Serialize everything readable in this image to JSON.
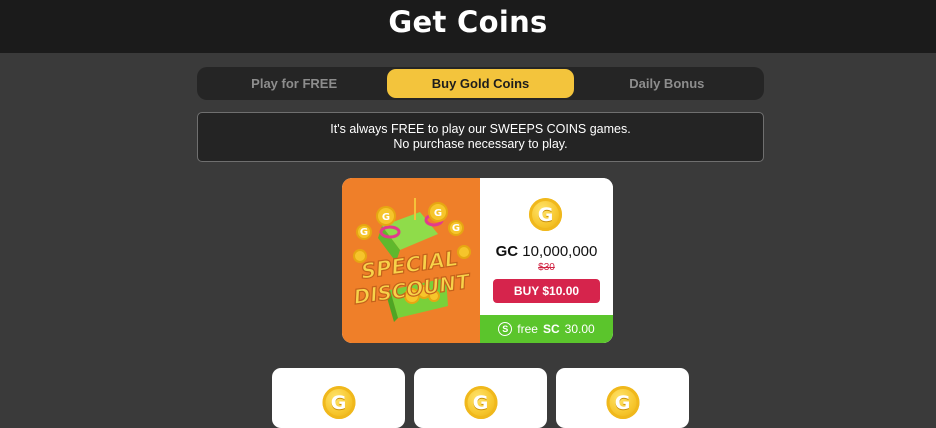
{
  "header": {
    "title": "Get Coins"
  },
  "tabs": [
    {
      "label": "Play for FREE",
      "active": false
    },
    {
      "label": "Buy Gold Coins",
      "active": true
    },
    {
      "label": "Daily Bonus",
      "active": false
    }
  ],
  "notice": {
    "line1": "It's always FREE to play our SWEEPS COINS games.",
    "line2": "No purchase necessary to play."
  },
  "promo": {
    "banner_line1": "SPECIAL",
    "banner_line2": "DISCOUNT",
    "coin_letter": "G",
    "gc_prefix": "GC",
    "gc_amount": "10,000,000",
    "old_price": "$30",
    "buy_label": "BUY $10.00",
    "free_prefix": "free",
    "sc_icon_letter": "S",
    "sc_label": "SC",
    "sc_amount": "30.00"
  },
  "cards": [
    {
      "coin_letter": "G"
    },
    {
      "coin_letter": "G"
    },
    {
      "coin_letter": "G"
    }
  ],
  "colors": {
    "accent": "#f3c43c",
    "buy": "#d6244c",
    "free_bar": "#5bc52c",
    "promo_bg": "#ef7f29"
  },
  "icons": [
    "gold-coin-icon",
    "sweeps-coin-icon",
    "gift-box-icon"
  ]
}
